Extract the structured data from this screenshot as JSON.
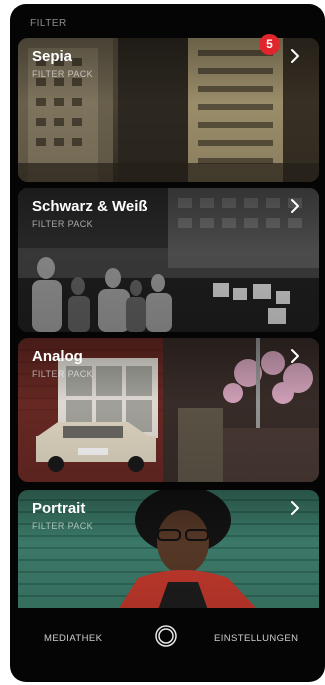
{
  "section": {
    "title": "FILTER"
  },
  "badge": {
    "count": "5"
  },
  "filters": [
    {
      "title": "Sepia",
      "subtitle": "FILTER PACK"
    },
    {
      "title": "Schwarz & Weiß",
      "subtitle": "FILTER PACK"
    },
    {
      "title": "Analog",
      "subtitle": "FILTER PACK"
    },
    {
      "title": "Portrait",
      "subtitle": "FILTER PACK"
    }
  ],
  "tabbar": {
    "library_label": "MEDIATHEK",
    "settings_label": "EINSTELLUNGEN"
  },
  "colors": {
    "badge": "#e0262c",
    "background": "#050505",
    "sepia": "#8a7a5c"
  },
  "icons": {
    "chevron": "chevron-right-icon",
    "shutter": "shutter-icon"
  }
}
